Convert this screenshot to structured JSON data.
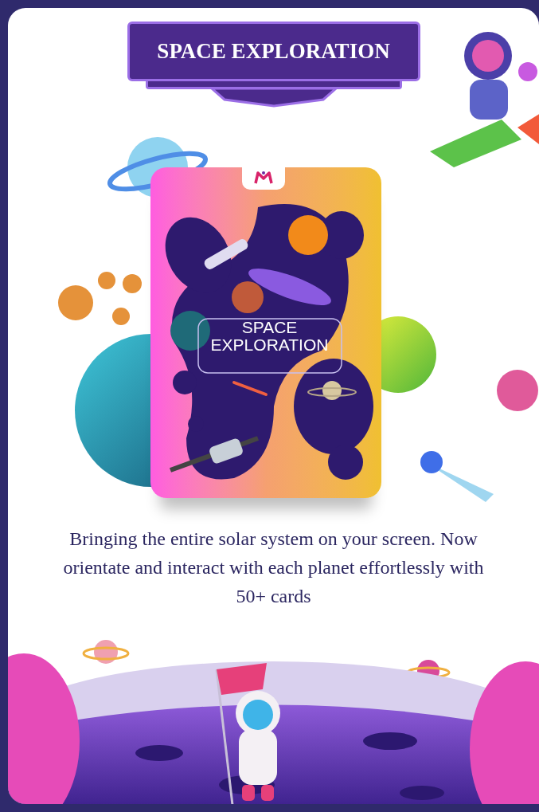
{
  "banner": {
    "title": "SPACE EXPLORATION"
  },
  "card": {
    "title_line_1": "SPACE",
    "title_line_2": "EXPLORATION"
  },
  "description": "Bringing the entire solar system on your screen. Now orientate and interact with each planet effortlessly with 50+ cards"
}
